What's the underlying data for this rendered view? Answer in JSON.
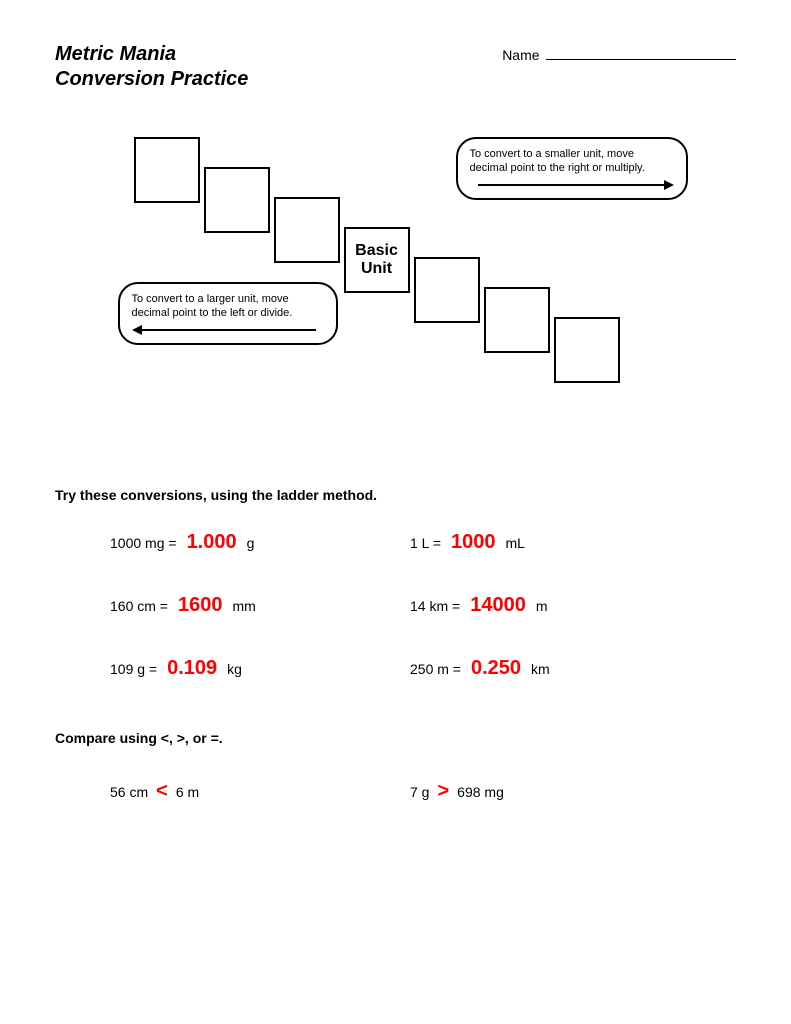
{
  "header": {
    "title_line1": "Metric Mania",
    "title_line2": "Conversion Practice",
    "name_label": "Name"
  },
  "diagram": {
    "basic_unit": "Basic\nUnit",
    "callout_right": "To convert to a smaller unit, move decimal  point to the right or multiply.",
    "callout_left": "To convert to a larger unit, move decimal  point to the left or divide."
  },
  "sections": {
    "conversions_heading": "Try these conversions, using the ladder method.",
    "compare_heading": "Compare using <, >, or =."
  },
  "conversions": [
    [
      {
        "q": "1000 mg =",
        "a": "1.000",
        "u": "g"
      },
      {
        "q": "1 L =",
        "a": "1000",
        "u": "mL"
      }
    ],
    [
      {
        "q": "160 cm =",
        "a": "1600",
        "u": "mm"
      },
      {
        "q": "14 km =",
        "a": "14000",
        "u": "m"
      }
    ],
    [
      {
        "q": "109 g =",
        "a": "0.109",
        "u": "kg"
      },
      {
        "q": "250 m =",
        "a": "0.250",
        "u": "km"
      }
    ]
  ],
  "comparisons": [
    [
      {
        "left": "56 cm",
        "op": "<",
        "right": "6 m"
      },
      {
        "left": "7 g",
        "op": ">",
        "right": "698 mg"
      }
    ]
  ]
}
